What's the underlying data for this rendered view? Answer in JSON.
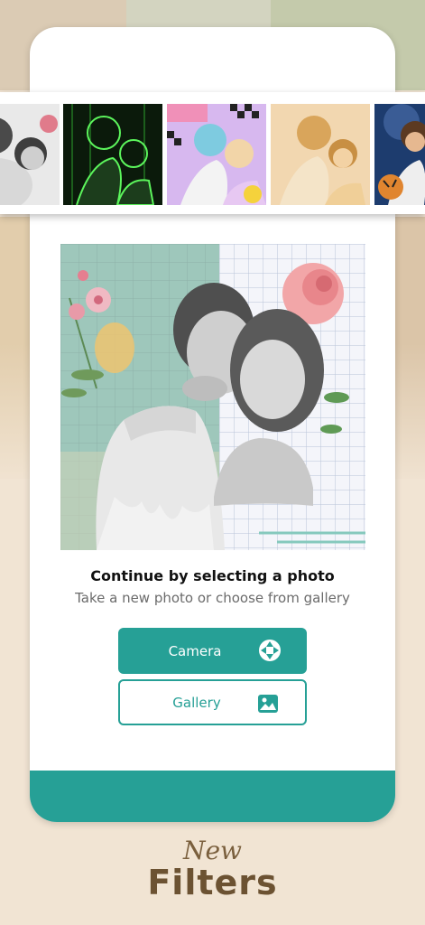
{
  "theme": {
    "accent": "#26a096",
    "background": "#f1e4d3",
    "promo_text": "#6c5232"
  },
  "filters": {
    "items": [
      {
        "name": "filter-sketch-bw"
      },
      {
        "name": "filter-neon-green"
      },
      {
        "name": "filter-pop-art"
      },
      {
        "name": "filter-warm-vintage"
      },
      {
        "name": "filter-tiger-night"
      }
    ]
  },
  "picker": {
    "title": "Continue by selecting a photo",
    "subtitle": "Take a new photo or choose from gallery",
    "camera_label": "Camera",
    "gallery_label": "Gallery",
    "camera_icon": "camera-shutter-icon",
    "gallery_icon": "image-icon"
  },
  "promo": {
    "line1": "New",
    "line2": "Filters"
  }
}
